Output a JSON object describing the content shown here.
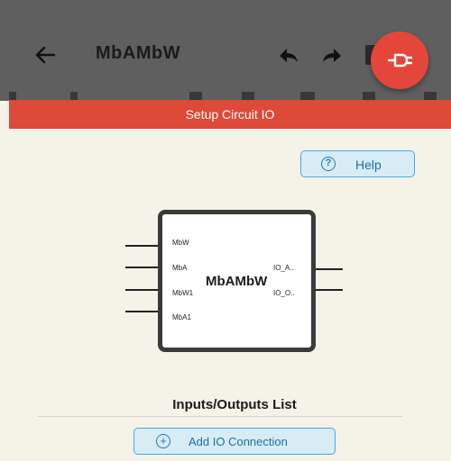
{
  "header": {
    "project_title": "MbAMbW",
    "back_icon": "arrow-left-icon",
    "undo_icon": "undo-icon",
    "redo_icon": "redo-icon",
    "fab_icon": "plug-icon",
    "colors": {
      "toolbar_bg": "#5f5f5f",
      "fab": "#e4473a"
    }
  },
  "dialog": {
    "title": "Setup Circuit IO",
    "header_color": "#de4a38",
    "help_label": "Help",
    "help_icon": "question-circle-icon",
    "chip": {
      "name": "MbAMbW",
      "inputs": [
        "MbW",
        "MbA",
        "MbW1",
        "MbA1"
      ],
      "outputs": [
        "IO_A..",
        "IO_O.."
      ]
    },
    "io_list_title": "Inputs/Outputs List",
    "add_button_label": "Add IO Connection",
    "add_icon": "plus-circle-icon",
    "button_color": "#d7ecf5"
  }
}
